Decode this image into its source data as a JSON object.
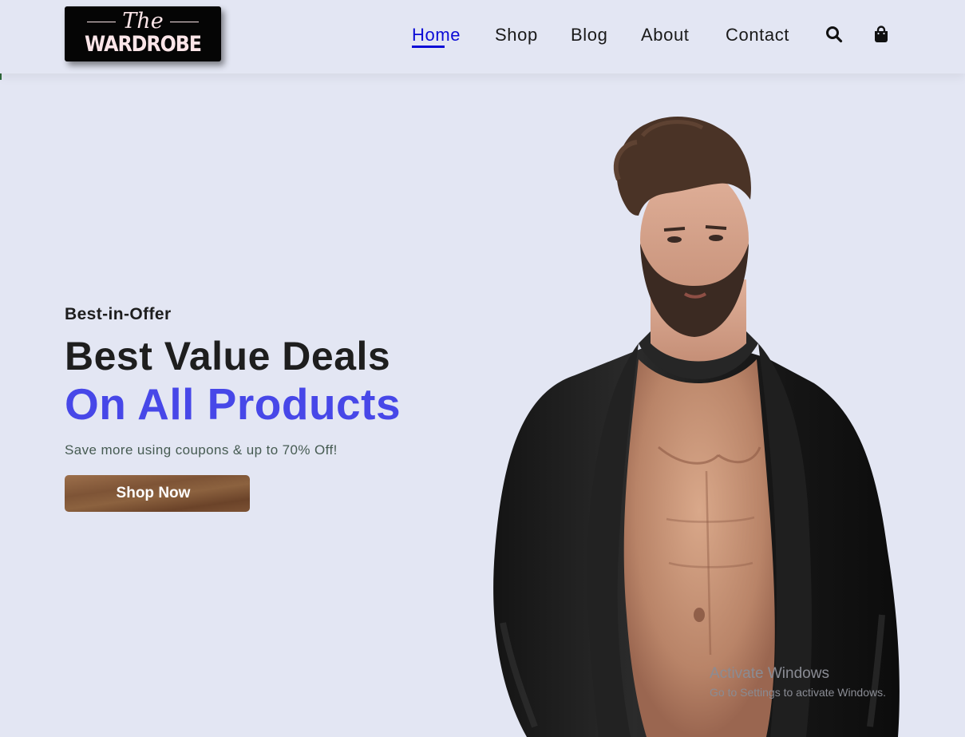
{
  "brand": {
    "logo_top": "The",
    "logo_bottom": "WARDROBE"
  },
  "nav": {
    "items": [
      {
        "label": "Home",
        "active": true
      },
      {
        "label": "Shop",
        "active": false
      },
      {
        "label": "Blog",
        "active": false
      },
      {
        "label": "About",
        "active": false
      },
      {
        "label": "Contact",
        "active": false
      }
    ],
    "icons": [
      "search-icon",
      "shopping-bag-icon"
    ]
  },
  "hero": {
    "kicker": "Best-in-Offer",
    "headline_line1": "Best Value Deals",
    "headline_line2": "On All Products",
    "subtext": "Save more using coupons & up to 70% Off!",
    "cta_label": "Shop Now"
  },
  "watermark": {
    "line1": "Activate Windows",
    "line2": "Go to Settings to activate Windows."
  },
  "colors": {
    "background": "#e3e6f3",
    "accent": "#4747e8",
    "nav_active": "#0b0bd6",
    "text_dark": "#1e1e1e",
    "button_brown": "#7e5436"
  }
}
